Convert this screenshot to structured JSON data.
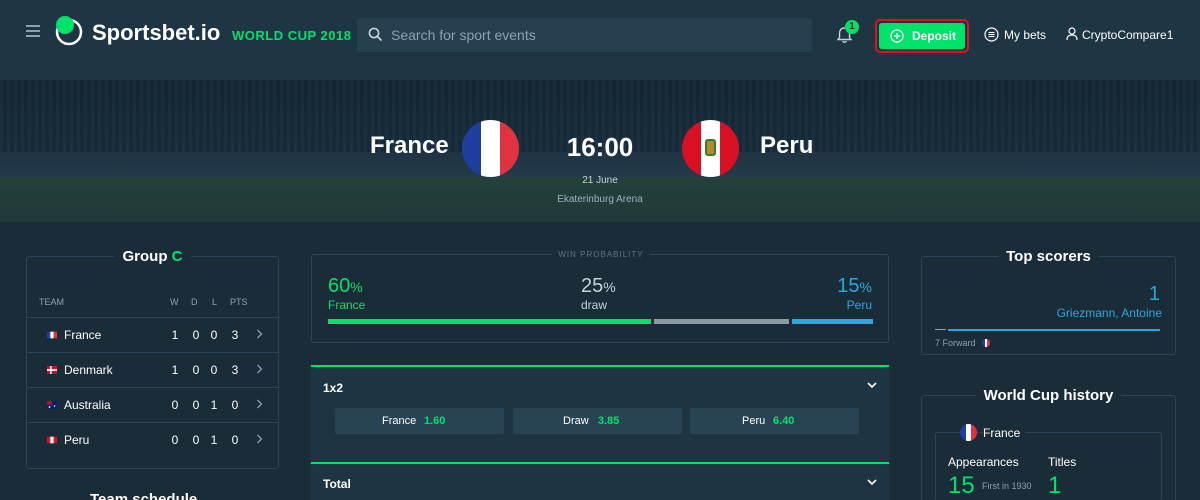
{
  "header": {
    "brand": "Sportsbet.io",
    "tournament": "WORLD CUP 2018",
    "search_placeholder": "Search for sport events",
    "notification_count": "1",
    "deposit_label": "Deposit",
    "my_bets_label": "My bets",
    "username": "CryptoCompare1"
  },
  "match": {
    "home_team": "France",
    "away_team": "Peru",
    "kickoff": "16:00",
    "date": "21 June",
    "venue": "Ekaterinburg Arena"
  },
  "group": {
    "title_prefix": "Group",
    "letter": "C",
    "columns": [
      "TEAM",
      "W",
      "D",
      "L",
      "PTS"
    ],
    "rows": [
      {
        "team": "France",
        "w": "1",
        "d": "0",
        "l": "0",
        "pts": "3"
      },
      {
        "team": "Denmark",
        "w": "1",
        "d": "0",
        "l": "0",
        "pts": "3"
      },
      {
        "team": "Australia",
        "w": "0",
        "d": "0",
        "l": "1",
        "pts": "0"
      },
      {
        "team": "Peru",
        "w": "0",
        "d": "0",
        "l": "1",
        "pts": "0"
      }
    ],
    "next_section_title": "Team schedule"
  },
  "win_probability": {
    "title": "WIN PROBABILITY",
    "home": {
      "value": "60",
      "label": "France"
    },
    "draw": {
      "value": "25",
      "label": "draw"
    },
    "away": {
      "value": "15",
      "label": "Peru"
    },
    "percent_sign": "%"
  },
  "markets": {
    "one_x_two": {
      "title": "1x2",
      "outcomes": [
        {
          "label": "France",
          "odds": "1.60"
        },
        {
          "label": "Draw",
          "odds": "3.85"
        },
        {
          "label": "Peru",
          "odds": "6.40"
        }
      ]
    },
    "total": {
      "title": "Total"
    }
  },
  "top_scorers": {
    "title": "Top scorers",
    "player": "Griezmann, Antoine",
    "goals": "1",
    "meta": "7 Forward"
  },
  "history": {
    "title": "World Cup history",
    "team": "France",
    "appearances_label": "Appearances",
    "appearances_value": "15",
    "first_label": "First in 1930",
    "titles_label": "Titles",
    "titles_value": "1"
  },
  "colors": {
    "accent_green": "#00e36b",
    "away_blue": "#2aa7e0",
    "draw_grey": "#8c9aa4",
    "background": "#1a2c38"
  },
  "icons": [
    "hamburger-icon",
    "search-icon",
    "bell-icon",
    "plus-circle-icon",
    "list-icon",
    "user-icon",
    "chevron-right-icon",
    "chevron-down-icon"
  ]
}
